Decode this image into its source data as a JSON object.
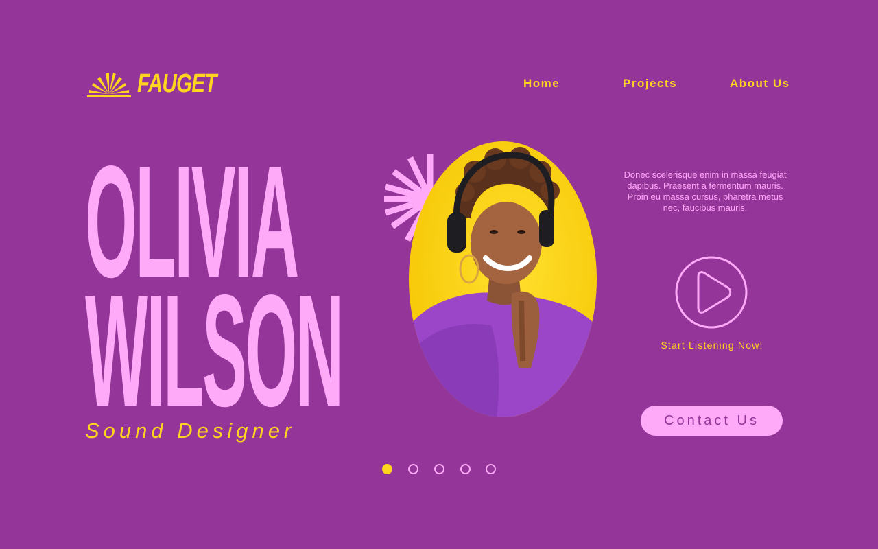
{
  "brand": {
    "name": "FAUGET",
    "logo_icon": "sunrise-rays-icon"
  },
  "nav": {
    "items": [
      {
        "label": "Home"
      },
      {
        "label": "Projects"
      },
      {
        "label": "About Us"
      }
    ]
  },
  "hero": {
    "first_name": "OLIVIA",
    "last_name": "WILSON",
    "role": "Sound Designer",
    "burst_icon": "starburst-icon",
    "portrait": "woman-with-headphones-photo"
  },
  "blurb": {
    "text": "Donec scelerisque enim in massa feugiat dapibus. Praesent a fermentum mauris. Proin eu massa cursus, pharetra metus nec, faucibus mauris."
  },
  "player": {
    "icon": "play-icon",
    "label": "Start Listening Now!"
  },
  "cta": {
    "label": "Contact Us"
  },
  "carousel": {
    "count": 5,
    "active_index": 0
  },
  "colors": {
    "background": "#943599",
    "accent_yellow": "#FFD51F",
    "accent_pink": "#FFAAF9"
  }
}
